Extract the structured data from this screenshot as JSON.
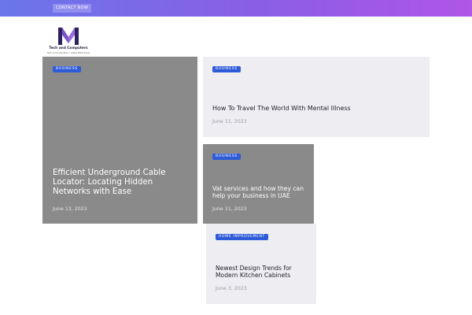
{
  "header": {
    "contact_label": "CONTACT NOW"
  },
  "brand": {
    "name": "Tech and Computers",
    "tagline": "Tech and Computers • Latest 360 Articles"
  },
  "posts": [
    {
      "category": "BUSINESS",
      "title": "Efficient Underground Cable Locator: Locating Hidden Networks with Ease",
      "date": "June 13, 2023"
    },
    {
      "category": "BUSINESS",
      "title": "How To Travel The World With Mental Illness",
      "date": "June 11, 2023"
    },
    {
      "category": "BUSINESS",
      "title": "Vat services and how they can help your business in UAE",
      "date": "June 11, 2023"
    },
    {
      "category": "HOME IMPROVEMENT",
      "title": "Newest Design Trends for Modern Kitchen Cabinets",
      "date": "June 3, 2023"
    }
  ],
  "colors": {
    "topbar_start": "#6a76ea",
    "topbar_end": "#b055e6",
    "badge": "#2e5bd8",
    "card_gray": "#8a8a8a",
    "card_light": "#ededf2"
  }
}
